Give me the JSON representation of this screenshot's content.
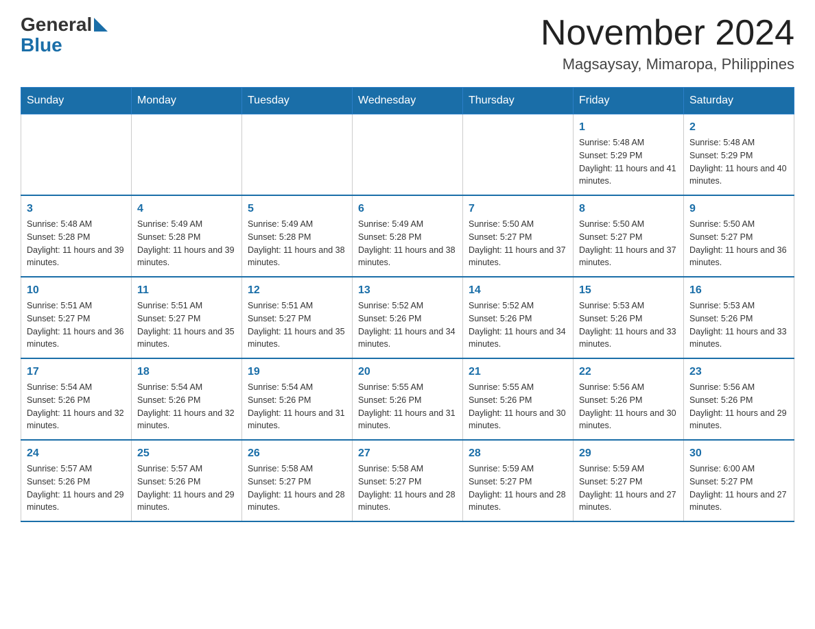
{
  "header": {
    "logo_general": "General",
    "logo_blue": "Blue",
    "month_title": "November 2024",
    "location": "Magsaysay, Mimaropa, Philippines"
  },
  "weekdays": [
    "Sunday",
    "Monday",
    "Tuesday",
    "Wednesday",
    "Thursday",
    "Friday",
    "Saturday"
  ],
  "weeks": [
    [
      {
        "day": "",
        "sunrise": "",
        "sunset": "",
        "daylight": ""
      },
      {
        "day": "",
        "sunrise": "",
        "sunset": "",
        "daylight": ""
      },
      {
        "day": "",
        "sunrise": "",
        "sunset": "",
        "daylight": ""
      },
      {
        "day": "",
        "sunrise": "",
        "sunset": "",
        "daylight": ""
      },
      {
        "day": "",
        "sunrise": "",
        "sunset": "",
        "daylight": ""
      },
      {
        "day": "1",
        "sunrise": "Sunrise: 5:48 AM",
        "sunset": "Sunset: 5:29 PM",
        "daylight": "Daylight: 11 hours and 41 minutes."
      },
      {
        "day": "2",
        "sunrise": "Sunrise: 5:48 AM",
        "sunset": "Sunset: 5:29 PM",
        "daylight": "Daylight: 11 hours and 40 minutes."
      }
    ],
    [
      {
        "day": "3",
        "sunrise": "Sunrise: 5:48 AM",
        "sunset": "Sunset: 5:28 PM",
        "daylight": "Daylight: 11 hours and 39 minutes."
      },
      {
        "day": "4",
        "sunrise": "Sunrise: 5:49 AM",
        "sunset": "Sunset: 5:28 PM",
        "daylight": "Daylight: 11 hours and 39 minutes."
      },
      {
        "day": "5",
        "sunrise": "Sunrise: 5:49 AM",
        "sunset": "Sunset: 5:28 PM",
        "daylight": "Daylight: 11 hours and 38 minutes."
      },
      {
        "day": "6",
        "sunrise": "Sunrise: 5:49 AM",
        "sunset": "Sunset: 5:28 PM",
        "daylight": "Daylight: 11 hours and 38 minutes."
      },
      {
        "day": "7",
        "sunrise": "Sunrise: 5:50 AM",
        "sunset": "Sunset: 5:27 PM",
        "daylight": "Daylight: 11 hours and 37 minutes."
      },
      {
        "day": "8",
        "sunrise": "Sunrise: 5:50 AM",
        "sunset": "Sunset: 5:27 PM",
        "daylight": "Daylight: 11 hours and 37 minutes."
      },
      {
        "day": "9",
        "sunrise": "Sunrise: 5:50 AM",
        "sunset": "Sunset: 5:27 PM",
        "daylight": "Daylight: 11 hours and 36 minutes."
      }
    ],
    [
      {
        "day": "10",
        "sunrise": "Sunrise: 5:51 AM",
        "sunset": "Sunset: 5:27 PM",
        "daylight": "Daylight: 11 hours and 36 minutes."
      },
      {
        "day": "11",
        "sunrise": "Sunrise: 5:51 AM",
        "sunset": "Sunset: 5:27 PM",
        "daylight": "Daylight: 11 hours and 35 minutes."
      },
      {
        "day": "12",
        "sunrise": "Sunrise: 5:51 AM",
        "sunset": "Sunset: 5:27 PM",
        "daylight": "Daylight: 11 hours and 35 minutes."
      },
      {
        "day": "13",
        "sunrise": "Sunrise: 5:52 AM",
        "sunset": "Sunset: 5:26 PM",
        "daylight": "Daylight: 11 hours and 34 minutes."
      },
      {
        "day": "14",
        "sunrise": "Sunrise: 5:52 AM",
        "sunset": "Sunset: 5:26 PM",
        "daylight": "Daylight: 11 hours and 34 minutes."
      },
      {
        "day": "15",
        "sunrise": "Sunrise: 5:53 AM",
        "sunset": "Sunset: 5:26 PM",
        "daylight": "Daylight: 11 hours and 33 minutes."
      },
      {
        "day": "16",
        "sunrise": "Sunrise: 5:53 AM",
        "sunset": "Sunset: 5:26 PM",
        "daylight": "Daylight: 11 hours and 33 minutes."
      }
    ],
    [
      {
        "day": "17",
        "sunrise": "Sunrise: 5:54 AM",
        "sunset": "Sunset: 5:26 PM",
        "daylight": "Daylight: 11 hours and 32 minutes."
      },
      {
        "day": "18",
        "sunrise": "Sunrise: 5:54 AM",
        "sunset": "Sunset: 5:26 PM",
        "daylight": "Daylight: 11 hours and 32 minutes."
      },
      {
        "day": "19",
        "sunrise": "Sunrise: 5:54 AM",
        "sunset": "Sunset: 5:26 PM",
        "daylight": "Daylight: 11 hours and 31 minutes."
      },
      {
        "day": "20",
        "sunrise": "Sunrise: 5:55 AM",
        "sunset": "Sunset: 5:26 PM",
        "daylight": "Daylight: 11 hours and 31 minutes."
      },
      {
        "day": "21",
        "sunrise": "Sunrise: 5:55 AM",
        "sunset": "Sunset: 5:26 PM",
        "daylight": "Daylight: 11 hours and 30 minutes."
      },
      {
        "day": "22",
        "sunrise": "Sunrise: 5:56 AM",
        "sunset": "Sunset: 5:26 PM",
        "daylight": "Daylight: 11 hours and 30 minutes."
      },
      {
        "day": "23",
        "sunrise": "Sunrise: 5:56 AM",
        "sunset": "Sunset: 5:26 PM",
        "daylight": "Daylight: 11 hours and 29 minutes."
      }
    ],
    [
      {
        "day": "24",
        "sunrise": "Sunrise: 5:57 AM",
        "sunset": "Sunset: 5:26 PM",
        "daylight": "Daylight: 11 hours and 29 minutes."
      },
      {
        "day": "25",
        "sunrise": "Sunrise: 5:57 AM",
        "sunset": "Sunset: 5:26 PM",
        "daylight": "Daylight: 11 hours and 29 minutes."
      },
      {
        "day": "26",
        "sunrise": "Sunrise: 5:58 AM",
        "sunset": "Sunset: 5:27 PM",
        "daylight": "Daylight: 11 hours and 28 minutes."
      },
      {
        "day": "27",
        "sunrise": "Sunrise: 5:58 AM",
        "sunset": "Sunset: 5:27 PM",
        "daylight": "Daylight: 11 hours and 28 minutes."
      },
      {
        "day": "28",
        "sunrise": "Sunrise: 5:59 AM",
        "sunset": "Sunset: 5:27 PM",
        "daylight": "Daylight: 11 hours and 28 minutes."
      },
      {
        "day": "29",
        "sunrise": "Sunrise: 5:59 AM",
        "sunset": "Sunset: 5:27 PM",
        "daylight": "Daylight: 11 hours and 27 minutes."
      },
      {
        "day": "30",
        "sunrise": "Sunrise: 6:00 AM",
        "sunset": "Sunset: 5:27 PM",
        "daylight": "Daylight: 11 hours and 27 minutes."
      }
    ]
  ]
}
